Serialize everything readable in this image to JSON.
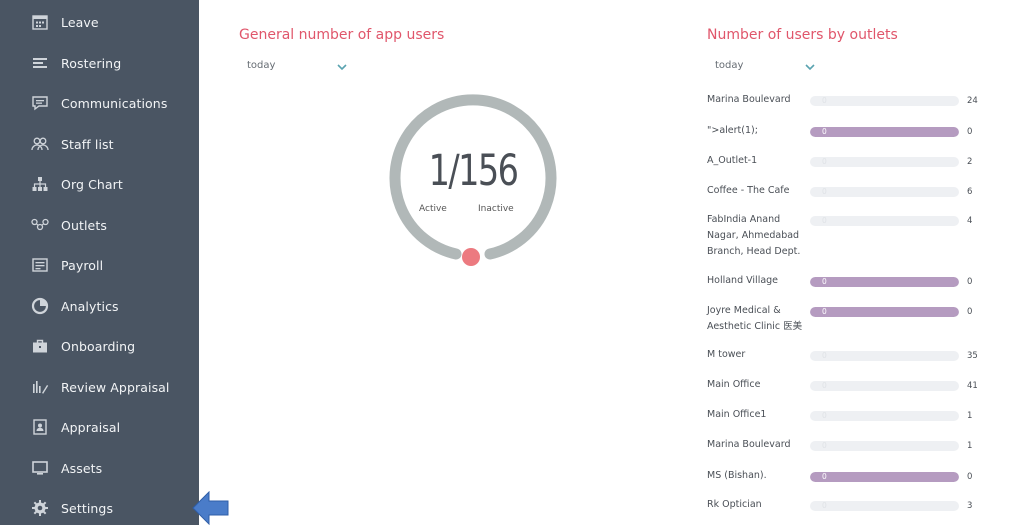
{
  "sidebar": {
    "items": [
      {
        "label": "Leave",
        "icon": "calendar-icon"
      },
      {
        "label": "Rostering",
        "icon": "roster-icon"
      },
      {
        "label": "Communications",
        "icon": "chat-icon"
      },
      {
        "label": "Staff list",
        "icon": "people-icon"
      },
      {
        "label": "Org Chart",
        "icon": "org-chart-icon"
      },
      {
        "label": "Outlets",
        "icon": "outlets-icon"
      },
      {
        "label": "Payroll",
        "icon": "payroll-icon"
      },
      {
        "label": "Analytics",
        "icon": "analytics-icon"
      },
      {
        "label": "Onboarding",
        "icon": "briefcase-icon"
      },
      {
        "label": "Review Appraisal",
        "icon": "review-icon"
      },
      {
        "label": "Appraisal",
        "icon": "appraisal-icon"
      },
      {
        "label": "Assets",
        "icon": "monitor-icon"
      },
      {
        "label": "Settings",
        "icon": "gear-icon"
      }
    ]
  },
  "app_users": {
    "title": "General number of app users",
    "period": "today",
    "active": "1",
    "total": "156",
    "count_display": "1/156",
    "active_label": "Active",
    "inactive_label": "Inactive"
  },
  "outlets": {
    "title": "Number of users by outlets",
    "period": "today",
    "rows": [
      {
        "name": "Marina Boulevard",
        "bar_text": "0",
        "count": "24"
      },
      {
        "name": "\">alert(1);",
        "bar_text": "0",
        "count": "0"
      },
      {
        "name": "A_Outlet-1",
        "bar_text": "0",
        "count": "2"
      },
      {
        "name": "Coffee - The Cafe",
        "bar_text": "0",
        "count": "6"
      },
      {
        "name": "FabIndia Anand Nagar, Ahmedabad Branch, Head Dept.",
        "bar_text": "0",
        "count": "4"
      },
      {
        "name": "Holland Village",
        "bar_text": "0",
        "count": "0"
      },
      {
        "name": "Joyre Medical & Aesthetic Clinic 医美",
        "bar_text": "0",
        "count": "0"
      },
      {
        "name": "M tower",
        "bar_text": "0",
        "count": "35"
      },
      {
        "name": "Main Office",
        "bar_text": "0",
        "count": "41"
      },
      {
        "name": "Main Office1",
        "bar_text": "0",
        "count": "1"
      },
      {
        "name": "Marina Boulevard",
        "bar_text": "0",
        "count": "1"
      },
      {
        "name": "MS (Bishan).",
        "bar_text": "0",
        "count": "0"
      },
      {
        "name": "Rk Optician",
        "bar_text": "0",
        "count": "3"
      }
    ]
  },
  "colors": {
    "sidebar_bg": "#4a5563",
    "accent_title": "#e0566b",
    "gauge_track": "#b1b8b8",
    "gauge_marker": "#ec7a80",
    "bar_fill": "#b59bc0",
    "bar_track": "#eef0f3",
    "chevron": "#5aa3b0",
    "pointer_arrow": "#4a7cc9"
  }
}
